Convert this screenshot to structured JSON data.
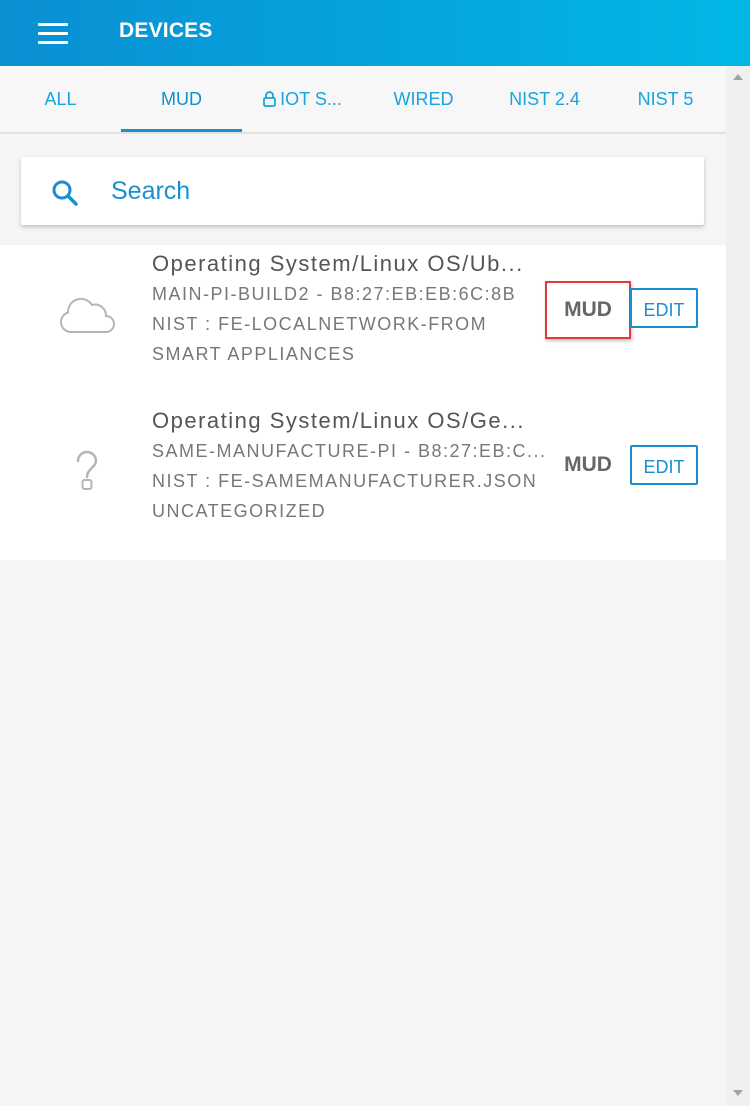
{
  "header": {
    "title": "DEVICES",
    "menu_icon": "hamburger-menu-icon"
  },
  "tabs": [
    {
      "label": "ALL",
      "active": false
    },
    {
      "label": "MUD",
      "active": true
    },
    {
      "label": "IOT S...",
      "active": false,
      "icon": "lock-icon"
    },
    {
      "label": "WIRED",
      "active": false
    },
    {
      "label": "NIST 2.4",
      "active": false
    },
    {
      "label": "NIST 5",
      "active": false
    }
  ],
  "search": {
    "placeholder": "Search",
    "icon": "search-icon"
  },
  "devices": [
    {
      "title": "Operating System/Linux OS/Ub...",
      "line1": "MAIN-PI-BUILD2 - B8:27:EB:EB:6C:8B",
      "line2": "NIST : FE-LOCALNETWORK-FROM",
      "line3": "SMART APPLIANCES",
      "badge": "MUD",
      "badge_highlighted": true,
      "action": "EDIT",
      "icon": "cloud-icon"
    },
    {
      "title": "Operating System/Linux OS/Ge...",
      "line1": "SAME-MANUFACTURE-PI - B8:27:EB:C...",
      "line2": "NIST : FE-SAMEMANUFACTURER.JSON",
      "line3": "UNCATEGORIZED",
      "badge": "MUD",
      "badge_highlighted": false,
      "action": "EDIT",
      "icon": "question-mark-icon"
    }
  ],
  "colors": {
    "accent": "#1a8fd0",
    "header_start": "#0a8fd3",
    "header_end": "#00b8e6",
    "highlight": "#e0393e"
  }
}
